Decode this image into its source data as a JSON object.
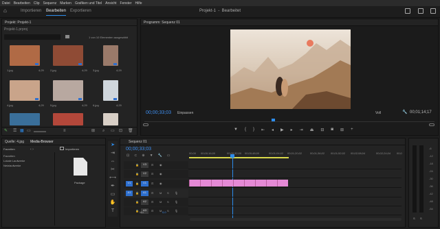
{
  "menu": [
    "Datei",
    "Bearbeiten",
    "Clip",
    "Sequenz",
    "Marken",
    "Grafiken und Titel",
    "Ansicht",
    "Fenster",
    "Hilfe"
  ],
  "workspace_tabs": [
    "Importieren",
    "Bearbeiten",
    "Exportieren"
  ],
  "window_title": "Projekt-1  -  Bearbeitet",
  "project": {
    "header": "Projekt: Projekt-1",
    "file": "Projekt-1.prproj",
    "search_placeholder": "",
    "count": "1 von 10 Elementen ausgewählt",
    "items": [
      {
        "name": "1.jpg",
        "dur": "4;29",
        "color": "#b06a45"
      },
      {
        "name": "2.jpg",
        "dur": "4;29",
        "color": "#8f4b35"
      },
      {
        "name": "3.jpg",
        "dur": "4;29",
        "color": "#9a7a6a"
      },
      {
        "name": "4.jpg",
        "dur": "4;29",
        "color": "#c9a48a"
      },
      {
        "name": "5.jpg",
        "dur": "4;29",
        "color": "#b8a8a0"
      },
      {
        "name": "6.jpg",
        "dur": "4;29",
        "color": "#cfd6dc"
      },
      {
        "name": "",
        "dur": "",
        "color": "#3a6f9a"
      },
      {
        "name": "",
        "dur": "",
        "color": "#b3473a"
      },
      {
        "name": "",
        "dur": "",
        "color": "#d8cfc6"
      }
    ]
  },
  "program": {
    "header": "Programm: Sequenz 01",
    "timecode": "00;00;33;03",
    "fit": "Einpassen",
    "quality": "Voll",
    "duration": "00;01;14;17"
  },
  "source": {
    "tabs": [
      "Quelle: 4.jpg",
      "Media-Browser"
    ],
    "favorites": "Favoriten",
    "importers_label": "Importieren",
    "tree": [
      "Favoriten",
      "Lokale Laufwerke",
      "Netzlaufwerke"
    ],
    "package_label": "Package"
  },
  "timeline": {
    "header": "Sequenz 01",
    "timecode": "00;00;33;03",
    "ruler": [
      "00;00",
      "00;00;16;00",
      "00;00;32;00",
      "00;00;48;00",
      "00;01;04;02",
      "00;01;20;02",
      "00;01;36;02",
      "00;01;52;02",
      "00;02;08;04",
      "00;02;24;04",
      "00;0"
    ],
    "tracks": [
      {
        "id": "V3",
        "src": ""
      },
      {
        "id": "V2",
        "src": ""
      },
      {
        "id": "V1",
        "src": "V1"
      },
      {
        "id": "A1",
        "src": "A1"
      },
      {
        "id": "A2",
        "src": ""
      },
      {
        "id": "A3",
        "src": ""
      }
    ],
    "mix_label": "Mix",
    "mix_value": "0,0",
    "clip_color": "#e58ad6"
  },
  "meter": {
    "labels": [
      "-6",
      "-12",
      "-18",
      "-24",
      "-30",
      "-36",
      "-42",
      "-48",
      "-54"
    ],
    "bottom": [
      "S",
      "S"
    ]
  },
  "colors": {
    "accent": "#2d8ceb",
    "clip": "#e58ad6",
    "tc": "#3e8ff0"
  }
}
